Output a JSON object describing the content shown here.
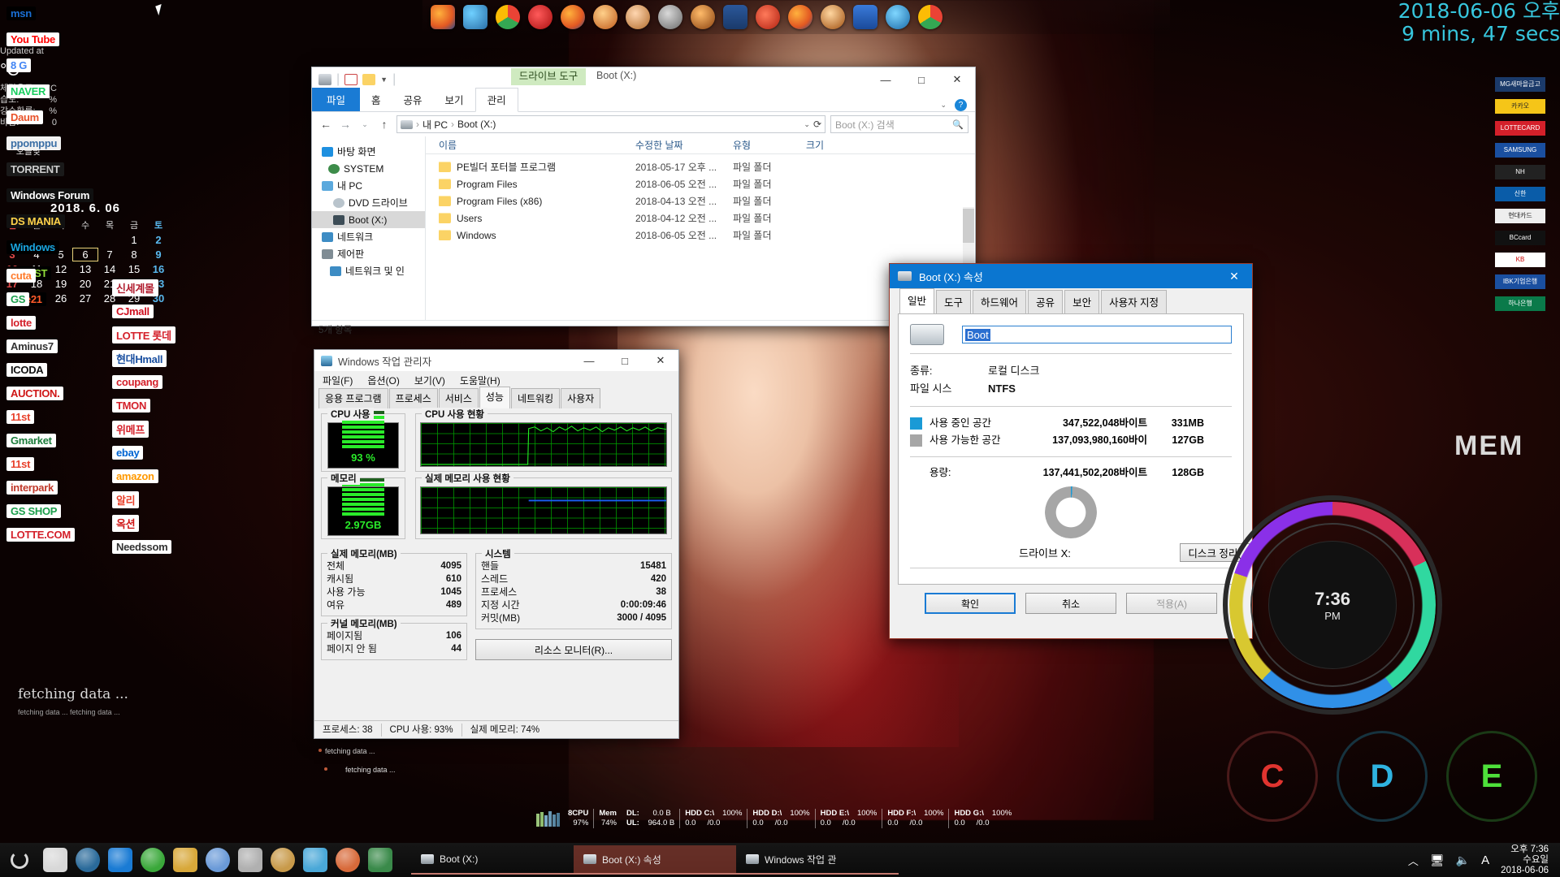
{
  "desktop": {
    "cursor": "mouse-cursor",
    "fetching_main": "fetching data ...",
    "fetching_sub": "fetching data ... fetching data ...",
    "tm_note_1": "fetching data ...",
    "tm_note_2": "fetching data ..."
  },
  "bookmarks_left": [
    {
      "label": "msn",
      "fg": "#1a6fd4",
      "bg": "#000000"
    },
    {
      "label": "You Tube",
      "fg": "#ff0000",
      "bg": "#ffffff"
    },
    {
      "label": "8 G",
      "fg": "#4285f4",
      "bg": "#ffffff"
    },
    {
      "label": "NAVER",
      "fg": "#19ce60",
      "bg": "#ffffff"
    },
    {
      "label": "Daum",
      "fg": "#e8522a",
      "bg": "#ffffff"
    },
    {
      "label": "ppomppu",
      "fg": "#3a6ea5",
      "bg": "#f2f2f2"
    },
    {
      "label": "TORRENT",
      "fg": "#cccccc",
      "bg": "#1a1a1a"
    },
    {
      "label": "Windows Forum",
      "fg": "#ffffff",
      "bg": "#101010"
    },
    {
      "label": "DS MANIA",
      "fg": "#ffd24a",
      "bg": "#111111"
    },
    {
      "label": "Windows",
      "fg": "#19a6e0",
      "bg": "#000000"
    },
    {
      "label": "ARTIST",
      "fg": "#8fdc3a",
      "bg": "#000000"
    },
    {
      "label": "cine21",
      "fg": "#ff5a2a",
      "bg": "#000000"
    }
  ],
  "bookmarks_col1": [
    {
      "label": "cuta",
      "fg": "#ff7a2a",
      "bg": "#ffffff"
    },
    {
      "label": "GS",
      "fg": "#1a9e4b",
      "bg": "#ffffff"
    },
    {
      "label": "lotte",
      "fg": "#d4202a",
      "bg": "#ffffff"
    },
    {
      "label": "Aminus7",
      "fg": "#333333",
      "bg": "#ffffff"
    },
    {
      "label": "ICODA",
      "fg": "#111111",
      "bg": "#ffffff"
    },
    {
      "label": "AUCTION.",
      "fg": "#cf1616",
      "bg": "#ffffff"
    },
    {
      "label": "11st",
      "fg": "#e8402a",
      "bg": "#ffffff"
    },
    {
      "label": "Gmarket",
      "fg": "#1a7b3a",
      "bg": "#ffffff"
    },
    {
      "label": "11st",
      "fg": "#e8402a",
      "bg": "#ffffff"
    },
    {
      "label": "interpark",
      "fg": "#c0392b",
      "bg": "#ffffff"
    },
    {
      "label": "GS SHOP",
      "fg": "#1a9e4b",
      "bg": "#ffffff"
    },
    {
      "label": "LOTTE.COM",
      "fg": "#d4202a",
      "bg": "#ffffff"
    }
  ],
  "bookmarks_col2": [
    {
      "label": "신세계몰",
      "fg": "#b01c2e",
      "bg": "#ffffff"
    },
    {
      "label": "CJmall",
      "fg": "#cf1020",
      "bg": "#ffffff"
    },
    {
      "label": "LOTTE 롯데",
      "fg": "#d4202a",
      "bg": "#ffffff"
    },
    {
      "label": "현대Hmall",
      "fg": "#1a4fa0",
      "bg": "#ffffff"
    },
    {
      "label": "coupang",
      "fg": "#d4202a",
      "bg": "#ffffff"
    },
    {
      "label": "TMON",
      "fg": "#d4202a",
      "bg": "#ffffff"
    },
    {
      "label": "위메프",
      "fg": "#d4202a",
      "bg": "#ffffff"
    },
    {
      "label": "ebay",
      "fg": "#0064d2",
      "bg": "#ffffff"
    },
    {
      "label": "amazon",
      "fg": "#ff9900",
      "bg": "#ffffff"
    },
    {
      "label": "알리",
      "fg": "#e8402a",
      "bg": "#ffffff"
    },
    {
      "label": "옥션",
      "fg": "#cf1616",
      "bg": "#ffffff"
    },
    {
      "label": "Needssom",
      "fg": "#333333",
      "bg": "#ffffff"
    }
  ],
  "explorer": {
    "window_name": "file-explorer",
    "title": "Boot (X:)",
    "context_tab": "드라이브 도구",
    "ribbon_tabs": [
      "파일",
      "홈",
      "공유",
      "보기",
      "관리"
    ],
    "active_ribbon_tab": "관리",
    "minimize": "—",
    "maximize": "□",
    "close": "✕",
    "help": "?",
    "address_parts": [
      "내 PC",
      "Boot (X:)"
    ],
    "search_placeholder": "Boot (X:) 검색",
    "tree": [
      {
        "label": "바탕 화면",
        "icon": "desktop-icon",
        "color": "#1e90e0",
        "indent": 12,
        "selected": false
      },
      {
        "label": "SYSTEM",
        "icon": "user-icon",
        "color": "#3d8c4a",
        "indent": 20,
        "selected": false
      },
      {
        "label": "내 PC",
        "icon": "computer-icon",
        "color": "#5ba9dd",
        "indent": 12,
        "selected": false
      },
      {
        "label": "DVD 드라이브",
        "icon": "disc-icon",
        "color": "#b9c4cc",
        "indent": 26,
        "selected": false
      },
      {
        "label": "Boot (X:)",
        "icon": "drive-icon",
        "color": "#3d4d57",
        "indent": 26,
        "selected": true
      },
      {
        "label": "네트워크",
        "icon": "network-icon",
        "color": "#3d8cc4",
        "indent": 12,
        "selected": false
      },
      {
        "label": "제어판",
        "icon": "controlpanel-icon",
        "color": "#7f8c94",
        "indent": 12,
        "selected": false
      },
      {
        "label": "네트워크 및 인",
        "icon": "network2-icon",
        "color": "#3d8cc4",
        "indent": 22,
        "selected": false
      }
    ],
    "columns": [
      "이름",
      "수정한 날짜",
      "유형",
      "크기"
    ],
    "files": [
      {
        "name": "PE빌더 포터블 프로그램",
        "date": "2018-05-17 오후 ...",
        "type": "파일 폴더",
        "size": ""
      },
      {
        "name": "Program Files",
        "date": "2018-06-05 오전 ...",
        "type": "파일 폴더",
        "size": ""
      },
      {
        "name": "Program Files (x86)",
        "date": "2018-04-13 오전 ...",
        "type": "파일 폴더",
        "size": ""
      },
      {
        "name": "Users",
        "date": "2018-04-12 오전 ...",
        "type": "파일 폴더",
        "size": ""
      },
      {
        "name": "Windows",
        "date": "2018-06-05 오전 ...",
        "type": "파일 폴더",
        "size": ""
      }
    ],
    "status": "5개 항목"
  },
  "taskmgr": {
    "window_name": "windows-task-manager",
    "title": "Windows 작업 관리자",
    "minimize": "—",
    "maximize": "□",
    "close": "✕",
    "menu": [
      "파일(F)",
      "옵션(O)",
      "보기(V)",
      "도움말(H)"
    ],
    "tabs": [
      "응용 프로그램",
      "프로세스",
      "서비스",
      "성능",
      "네트워킹",
      "사용자"
    ],
    "active_tab": "성능",
    "cpu_usage_label": "CPU 사용",
    "cpu_usage_value": "93 %",
    "cpu_history_label": "CPU 사용 현황",
    "mem_label": "메모리",
    "mem_value": "2.97GB",
    "mem_history_label": "실제 메모리 사용 현황",
    "physical_memory_label": "실제 메모리(MB)",
    "physical_memory": [
      {
        "k": "전체",
        "v": "4095"
      },
      {
        "k": "캐시됨",
        "v": "610"
      },
      {
        "k": "사용 가능",
        "v": "1045"
      },
      {
        "k": "여유",
        "v": "489"
      }
    ],
    "kernel_memory_label": "커널 메모리(MB)",
    "kernel_memory": [
      {
        "k": "페이지됨",
        "v": "106"
      },
      {
        "k": "페이지 안 됨",
        "v": "44"
      }
    ],
    "system_label": "시스템",
    "system": [
      {
        "k": "핸들",
        "v": "15481"
      },
      {
        "k": "스레드",
        "v": "420"
      },
      {
        "k": "프로세스",
        "v": "38"
      },
      {
        "k": "지정 시간",
        "v": "0:00:09:46"
      },
      {
        "k": "커밋(MB)",
        "v": "3000 / 4095"
      }
    ],
    "resource_monitor_button": "리소스 모니터(R)...",
    "statusbar": [
      "프로세스: 38",
      "CPU 사용: 93%",
      "실제 메모리: 74%"
    ]
  },
  "properties": {
    "window_name": "drive-properties-dialog",
    "title": "Boot (X:) 속성",
    "close": "✕",
    "tabs": [
      "일반",
      "도구",
      "하드웨어",
      "공유",
      "보안",
      "사용자 지정"
    ],
    "active_tab": "일반",
    "volume_label_value": "Boot",
    "type_key": "종류:",
    "type_value": "로컬 디스크",
    "fs_key": "파일 시스",
    "fs_value": "NTFS",
    "used_label": "사용 중인 공간",
    "used_bytes": "347,522,048바이트",
    "used_short": "331MB",
    "free_label": "사용 가능한 공간",
    "free_bytes": "137,093,980,160바이",
    "free_short": "127GB",
    "capacity_label": "용량:",
    "capacity_bytes": "137,441,502,208바이트",
    "capacity_short": "128GB",
    "drive_caption": "드라이브 X:",
    "cleanup_button": "디스크 정리(",
    "used_color": "#1a9ad6",
    "free_color": "#a6a6a6",
    "buttons": {
      "ok": "확인",
      "cancel": "취소",
      "apply": "적용(A)"
    }
  },
  "taskbar": {
    "start_icon": "start-orb-icon",
    "quick_icons": [
      "show-desktop-icon",
      "media-player-icon",
      "internet-explorer-icon",
      "clover-icon",
      "paint-icon",
      "tools-icon",
      "pen-icon",
      "archive-icon",
      "usb-icon",
      "browser-icon",
      "shield-icon"
    ],
    "tasks": [
      {
        "label": "Boot (X:)",
        "icon": "drive-icon",
        "active": false
      },
      {
        "label": "Boot (X:) 속성",
        "icon": "drive-icon",
        "active": true
      },
      {
        "label": "Windows 작업 관",
        "icon": "taskmgr-icon",
        "active": false
      }
    ],
    "tray_icons": [
      "chevron-up-icon",
      "network-icon",
      "volume-icon",
      "ime-A-icon"
    ],
    "clock_time": "오후 7:36",
    "clock_day": "수요일",
    "clock_date": "2018-06-06"
  },
  "gadgets": {
    "uptime_line1": "2018-06-06 오후",
    "uptime_line2": "9 mins, 47 secs",
    "weather": {
      "updated": "Updated at",
      "unit": "°C",
      "rows": [
        {
          "k": "체감온도:",
          "v": "°C"
        },
        {
          "k": "습도:",
          "v": "%"
        },
        {
          "k": "강수확률:",
          "v": "%"
        },
        {
          "k": "바람:",
          "v": "0"
        }
      ],
      "today": "오늘낮",
      "slash1": "/",
      "slash2": "/"
    },
    "calendar": {
      "title": "2018. 6.  06",
      "dow": [
        "일",
        "월",
        "화",
        "수",
        "목",
        "금",
        "토"
      ],
      "weeks": [
        [
          "",
          "",
          "",
          "",
          "",
          "1",
          "2"
        ],
        [
          "3",
          "4",
          "5",
          "6",
          "7",
          "8",
          "9"
        ],
        [
          "10",
          "11",
          "12",
          "13",
          "14",
          "15",
          "16"
        ],
        [
          "17",
          "18",
          "19",
          "20",
          "21",
          "22",
          "23"
        ],
        [
          "24",
          "25",
          "26",
          "27",
          "28",
          "29",
          "30"
        ]
      ],
      "today": "6"
    },
    "ring_time": "7:36",
    "ring_ampm": "PM",
    "mem_label": "MEM",
    "drive_circles": [
      {
        "letter": "C",
        "color": "#e0342f"
      },
      {
        "letter": "D",
        "color": "#2fb3e0"
      },
      {
        "letter": "E",
        "color": "#4ee03a"
      }
    ]
  },
  "monitor_bar": {
    "cpu_label": "8CPU",
    "cpu_value": "97%",
    "mem_label": "Mem",
    "mem_value": "74%",
    "dl_label": "DL:",
    "dl_value": "0.0 B",
    "ul_label": "UL:",
    "ul_value": "964.0 B",
    "drives": [
      {
        "name": "HDD C:\\",
        "pct": "100%",
        "used": "0.0",
        "total": "/0.0"
      },
      {
        "name": "HDD D:\\",
        "pct": "100%",
        "used": "0.0",
        "total": "/0.0"
      },
      {
        "name": "HDD E:\\",
        "pct": "100%",
        "used": "0.0",
        "total": "/0.0"
      },
      {
        "name": "HDD F:\\",
        "pct": "100%",
        "used": "0.0",
        "total": "/0.0"
      },
      {
        "name": "HDD G:\\",
        "pct": "100%",
        "used": "0.0",
        "total": "/0.0"
      }
    ]
  }
}
